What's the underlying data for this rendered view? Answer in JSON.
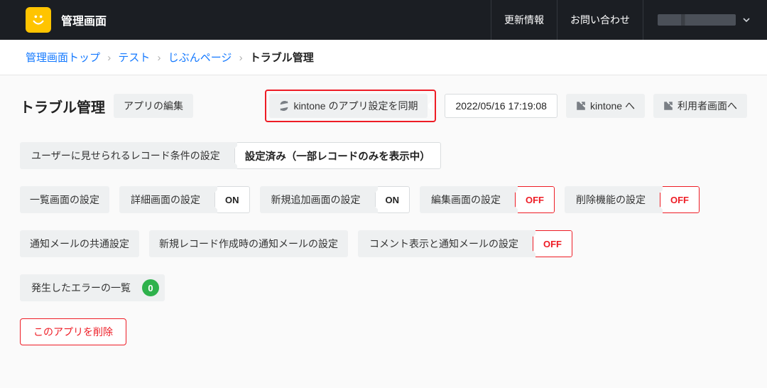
{
  "header": {
    "brand": "管理画面",
    "updates": "更新情報",
    "contact": "お問い合わせ"
  },
  "breadcrumb": {
    "items": [
      {
        "label": "管理画面トップ",
        "current": false
      },
      {
        "label": "テスト",
        "current": false
      },
      {
        "label": "じぶんページ",
        "current": false
      },
      {
        "label": "トラブル管理",
        "current": true
      }
    ]
  },
  "titlebar": {
    "title": "トラブル管理",
    "edit_app": "アプリの編集",
    "sync": "kintone のアプリ設定を同期",
    "timestamp": "2022/05/16 17:19:08",
    "to_kintone": "kintone へ",
    "to_user": "利用者画面へ"
  },
  "record_condition": {
    "label": "ユーザーに見せられるレコード条件の設定",
    "value": "設定済み（一部レコードのみを表示中）"
  },
  "screens": {
    "list": {
      "label": "一覧画面の設定"
    },
    "detail": {
      "label": "詳細画面の設定",
      "value": "ON"
    },
    "create": {
      "label": "新規追加画面の設定",
      "value": "ON"
    },
    "edit": {
      "label": "編集画面の設定",
      "value": "OFF"
    },
    "delete": {
      "label": "削除機能の設定",
      "value": "OFF"
    }
  },
  "mail": {
    "shared": {
      "label": "通知メールの共通設定"
    },
    "create": {
      "label": "新規レコード作成時の通知メールの設定"
    },
    "comment": {
      "label": "コメント表示と通知メールの設定",
      "value": "OFF"
    }
  },
  "errors": {
    "label": "発生したエラーの一覧",
    "count": "0"
  },
  "delete_app": "このアプリを削除"
}
